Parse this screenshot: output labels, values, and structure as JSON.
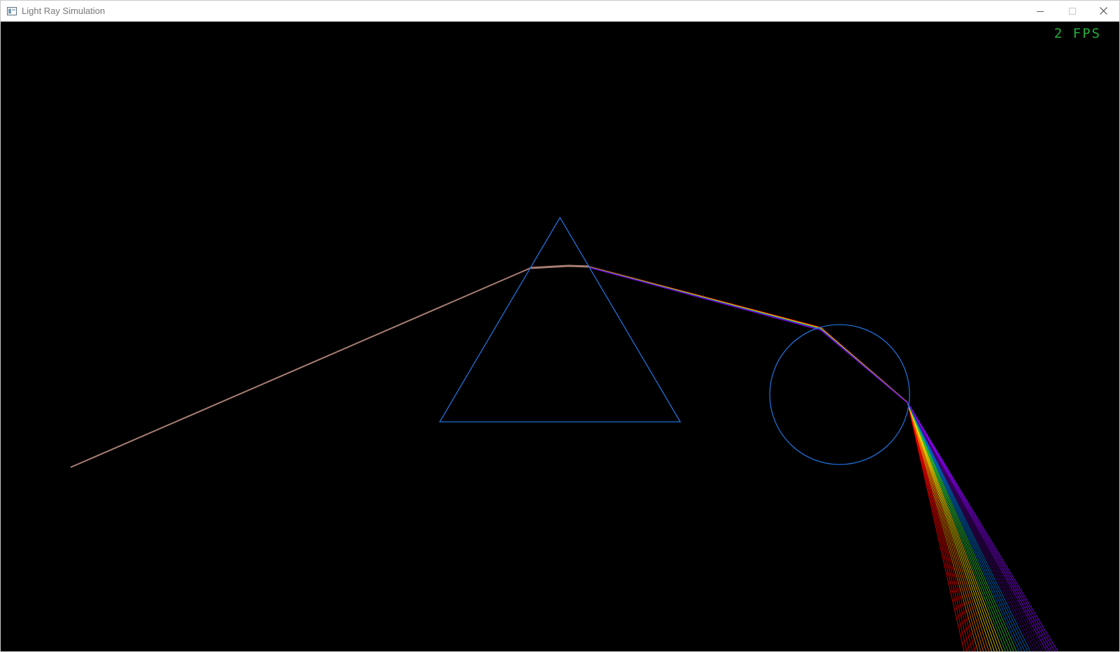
{
  "window": {
    "title": "Light Ray Simulation",
    "icon": "window-app-icon",
    "controls": {
      "minimize_icon": "minimize-icon",
      "maximize_icon": "maximize-icon",
      "close_icon": "close-icon"
    }
  },
  "hud": {
    "fps_text": "2 FPS",
    "fps_color": "#22b03a"
  },
  "scene": {
    "background_color": "#000000",
    "optics_color": "#1f6fd6",
    "incident_ray_color": "#a87e74",
    "spectrum_colors": [
      "#ff0000",
      "#ff7a00",
      "#ffe000",
      "#2ecc40",
      "#0074d9",
      "#4b0082",
      "#8f00ff"
    ],
    "objects": [
      {
        "kind": "prism",
        "shape": "triangle"
      },
      {
        "kind": "lens",
        "shape": "circle"
      }
    ]
  }
}
